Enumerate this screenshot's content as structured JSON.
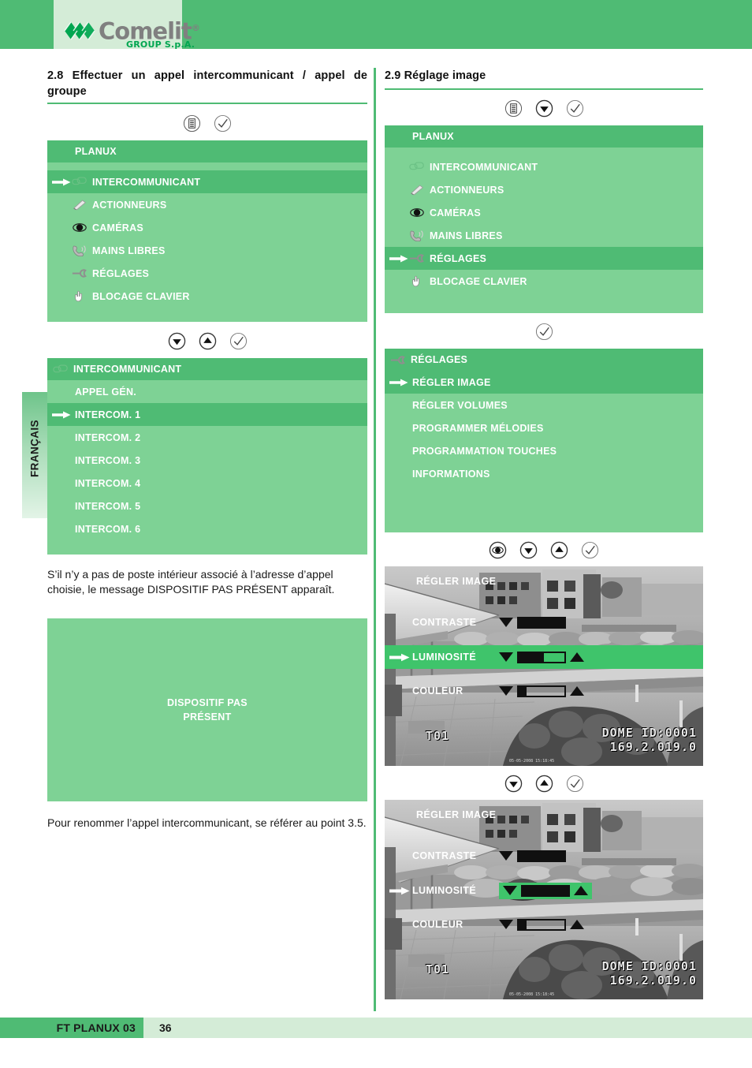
{
  "brand": {
    "name": "Comelit",
    "registered": "®",
    "subtitle": "GROUP S.p.A."
  },
  "side_tab": {
    "label": "FRANÇAIS"
  },
  "left": {
    "section": {
      "title": "2.8 Effectuer un appel intercommunicant / appel de groupe"
    },
    "buttons_1": [
      "menu-icon",
      "check-icon"
    ],
    "screen_1": {
      "title": "PLANUX",
      "items": [
        {
          "label": "INTERCOMMUNICANT",
          "icon": "intercom-icon",
          "selected": true
        },
        {
          "label": "ACTIONNEURS",
          "icon": "actuator-icon",
          "selected": false
        },
        {
          "label": "CAMÉRAS",
          "icon": "camera-icon",
          "selected": false
        },
        {
          "label": "MAINS LIBRES",
          "icon": "handsfree-icon",
          "selected": false
        },
        {
          "label": "RÉGLAGES",
          "icon": "wrench-icon",
          "selected": false
        },
        {
          "label": "BLOCAGE CLAVIER",
          "icon": "hand-icon",
          "selected": false
        }
      ]
    },
    "buttons_2": [
      "down-icon",
      "up-icon",
      "check-icon"
    ],
    "screen_2": {
      "title": "INTERCOMMUNICANT",
      "title_icon": "intercom-icon",
      "items": [
        {
          "label": "APPEL GÉN.",
          "selected": false
        },
        {
          "label": "INTERCOM. 1",
          "selected": true
        },
        {
          "label": "INTERCOM. 2",
          "selected": false
        },
        {
          "label": "INTERCOM. 3",
          "selected": false
        },
        {
          "label": "INTERCOM. 4",
          "selected": false
        },
        {
          "label": "INTERCOM. 5",
          "selected": false
        },
        {
          "label": "INTERCOM. 6",
          "selected": false
        }
      ]
    },
    "paragraph_1": "S’il n’y a pas de poste intérieur associé à l’adresse d’appel choisie, le message DISPOSITIF PAS PRÉSENT apparaît.",
    "message_screen": {
      "line_1": "DISPOSITIF PAS",
      "line_2": "PRÉSENT"
    },
    "paragraph_2": "Pour renommer l’appel intercommunicant, se référer au point 3.5."
  },
  "right": {
    "section": {
      "title": "2.9 Réglage image"
    },
    "buttons_1": [
      "menu-icon",
      "down-icon",
      "check-icon"
    ],
    "screen_1": {
      "title": "PLANUX",
      "items": [
        {
          "label": "INTERCOMMUNICANT",
          "icon": "intercom-icon",
          "selected": false
        },
        {
          "label": "ACTIONNEURS",
          "icon": "actuator-icon",
          "selected": false
        },
        {
          "label": "CAMÉRAS",
          "icon": "camera-icon",
          "selected": false
        },
        {
          "label": "MAINS LIBRES",
          "icon": "handsfree-icon",
          "selected": false
        },
        {
          "label": "RÉGLAGES",
          "icon": "wrench-icon",
          "selected": true
        },
        {
          "label": "BLOCAGE CLAVIER",
          "icon": "hand-icon",
          "selected": false
        }
      ]
    },
    "buttons_2": [
      "check-icon"
    ],
    "screen_2": {
      "title": "RÉGLAGES",
      "title_icon": "wrench-icon",
      "items": [
        {
          "label": "RÉGLER IMAGE",
          "selected": true
        },
        {
          "label": "RÉGLER VOLUMES",
          "selected": false
        },
        {
          "label": "PROGRAMMER MÉLODIES",
          "selected": false
        },
        {
          "label": "PROGRAMMATION TOUCHES",
          "selected": false
        },
        {
          "label": "INFORMATIONS",
          "selected": false
        }
      ]
    },
    "buttons_3": [
      "camera-icon",
      "down-icon",
      "up-icon",
      "check-icon"
    ],
    "camera_1": {
      "osd_title": "RÉGLER IMAGE",
      "rows": [
        {
          "label": "CONTRASTE",
          "fill_pct": 100,
          "selected": false,
          "highlight": "none"
        },
        {
          "label": "LUMINOSITÉ",
          "fill_pct": 55,
          "selected": true,
          "highlight": "full-row"
        },
        {
          "label": "COULEUR",
          "fill_pct": 18,
          "selected": false,
          "highlight": "none"
        }
      ],
      "tag_left": "T01",
      "tag_right_line1": "DOME ID:0001",
      "tag_right_line2": "169.2.019.0",
      "timestamp": "05-05-2008 15:18:45"
    },
    "buttons_4": [
      "down-icon",
      "up-icon",
      "check-icon"
    ],
    "camera_2": {
      "osd_title": "RÉGLER IMAGE",
      "rows": [
        {
          "label": "CONTRASTE",
          "fill_pct": 100,
          "selected": false,
          "highlight": "none"
        },
        {
          "label": "LUMINOSITÉ",
          "fill_pct": 100,
          "selected": true,
          "highlight": "slider-box"
        },
        {
          "label": "COULEUR",
          "fill_pct": 18,
          "selected": false,
          "highlight": "none"
        }
      ],
      "tag_left": "T01",
      "tag_right_line1": "DOME ID:0001",
      "tag_right_line2": "169.2.019.0",
      "timestamp": "05-05-2008 15:18:45"
    }
  },
  "footer": {
    "doc_code": "FT PLANUX 03",
    "page_number": "36"
  },
  "colors": {
    "brand_green": "#4fbb74",
    "screen_green": "#7ed295",
    "pale_green": "#d4ecd7",
    "logo_gray": "#808080",
    "logo_green": "#00a650"
  }
}
